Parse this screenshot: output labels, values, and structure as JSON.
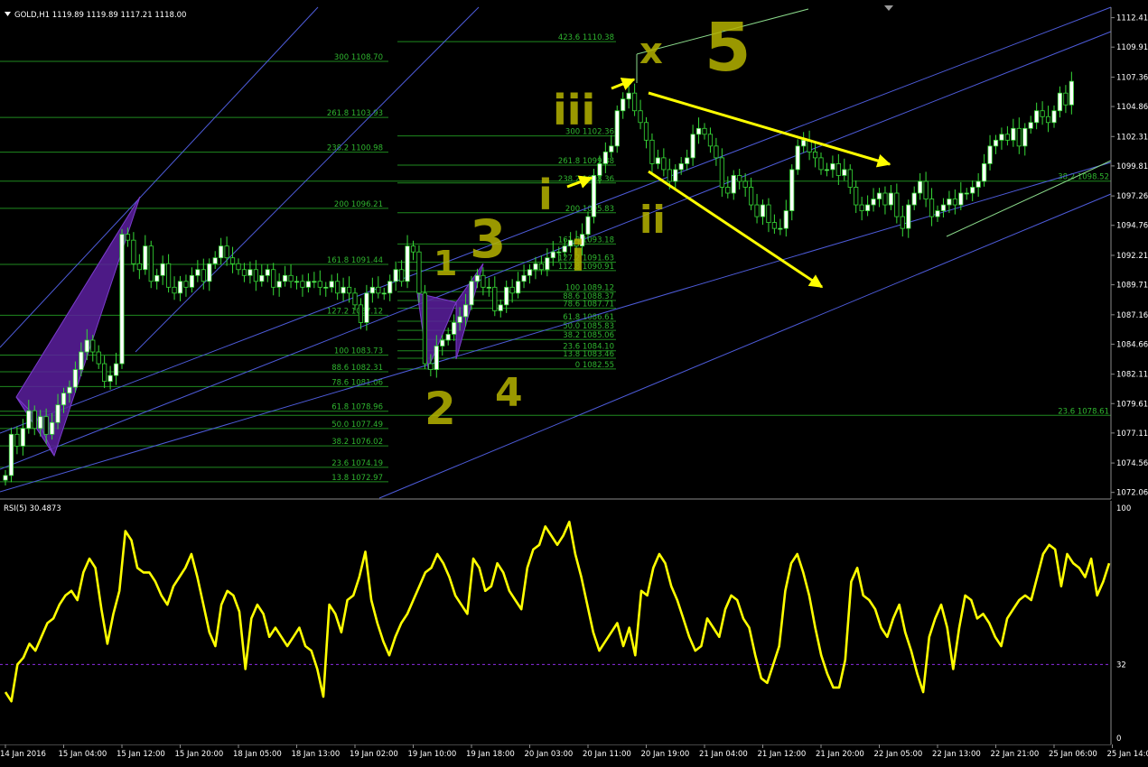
{
  "window": {
    "symbol_title": "GOLD,H1",
    "ohlc": "1119.89 1119.89 1117.21 1118.00",
    "title_full": "GOLD,H1  1119.89 1119.89 1117.21 1118.00"
  },
  "chart_data": [
    {
      "type": "line",
      "role": "candlestick-price",
      "title": "GOLD,H1",
      "ylim": [
        1071.5,
        1113.3
      ],
      "y_ticks": [
        "1112.41",
        "1109.91",
        "1107.36",
        "1104.86",
        "1102.31",
        "1099.81",
        "1097.26",
        "1094.76",
        "1092.21",
        "1089.71",
        "1087.16",
        "1084.66",
        "1082.11",
        "1079.61",
        "1077.11",
        "1074.56",
        "1072.06"
      ],
      "x_ticks": [
        "14 Jan 2016",
        "15 Jan 04:00",
        "15 Jan 12:00",
        "15 Jan 20:00",
        "18 Jan 05:00",
        "18 Jan 13:00",
        "19 Jan 02:00",
        "19 Jan 10:00",
        "19 Jan 18:00",
        "20 Jan 03:00",
        "20 Jan 11:00",
        "20 Jan 19:00",
        "21 Jan 04:00",
        "21 Jan 12:00",
        "21 Jan 20:00",
        "22 Jan 05:00",
        "22 Jan 13:00",
        "22 Jan 21:00",
        "25 Jan 06:00",
        "25 Jan 14:00"
      ],
      "x_tick_index": [
        0,
        10,
        20,
        30,
        40,
        50,
        60,
        70,
        80,
        90,
        100,
        110,
        120,
        130,
        140,
        150,
        160,
        170,
        180,
        190
      ],
      "candles_close_approx": [
        1073.5,
        1077.0,
        1076.0,
        1077.5,
        1079.0,
        1077.5,
        1078.5,
        1077.0,
        1078.0,
        1079.5,
        1080.5,
        1081.0,
        1082.5,
        1084.0,
        1085.0,
        1084.0,
        1083.0,
        1081.5,
        1082.0,
        1083.0,
        1094.0,
        1093.5,
        1091.5,
        1091.0,
        1093.0,
        1090.0,
        1090.5,
        1091.5,
        1089.5,
        1089.0,
        1090.0,
        1089.5,
        1090.5,
        1091.0,
        1090.0,
        1091.5,
        1092.0,
        1093.0,
        1092.0,
        1091.5,
        1091.0,
        1090.5,
        1091.0,
        1090.0,
        1090.5,
        1091.0,
        1089.5,
        1090.0,
        1090.5,
        1090.0,
        1090.0,
        1089.5,
        1090.0,
        1090.0,
        1089.5,
        1089.5,
        1090.0,
        1089.0,
        1089.5,
        1089.0,
        1088.0,
        1086.5,
        1089.0,
        1089.5,
        1089.0,
        1089.0,
        1090.0,
        1091.0,
        1090.0,
        1093.0,
        1092.5,
        1089.0,
        1083.0,
        1082.5,
        1084.5,
        1085.0,
        1085.5,
        1086.5,
        1087.0,
        1088.0,
        1090.0,
        1090.5,
        1089.5,
        1089.5,
        1087.5,
        1088.0,
        1089.5,
        1089.0,
        1090.0,
        1090.5,
        1091.0,
        1091.5,
        1091.0,
        1092.0,
        1092.5,
        1092.5,
        1093.0,
        1093.5,
        1093.0,
        1094.0,
        1095.5,
        1099.0,
        1100.0,
        1101.0,
        1101.5,
        1104.5,
        1105.5,
        1106.0,
        1104.5,
        1103.5,
        1102.0,
        1100.0,
        1100.5,
        1099.5,
        1098.5,
        1099.5,
        1100.0,
        1100.5,
        1102.5,
        1103.0,
        1102.5,
        1101.5,
        1100.5,
        1098.0,
        1097.5,
        1099.0,
        1098.5,
        1098.0,
        1096.5,
        1095.5,
        1096.5,
        1095.0,
        1094.5,
        1094.5,
        1096.0,
        1099.5,
        1101.5,
        1102.0,
        1101.0,
        1100.5,
        1099.5,
        1099.5,
        1100.0,
        1099.0,
        1099.5,
        1098.0,
        1096.5,
        1096.0,
        1096.5,
        1097.0,
        1097.5,
        1096.5,
        1097.5,
        1095.5,
        1094.5,
        1096.5,
        1097.5,
        1098.5,
        1097.0,
        1095.5,
        1096.0,
        1096.5,
        1097.0,
        1096.5,
        1097.5,
        1097.5,
        1098.0,
        1098.5,
        1100.0,
        1101.5,
        1102.0,
        1102.5,
        1102.0,
        1103.0,
        1101.5,
        1103.0,
        1103.5,
        1104.5,
        1104.0,
        1103.5,
        1104.5,
        1106.0,
        1105.0,
        1107.0
      ]
    },
    {
      "type": "line",
      "role": "indicator",
      "title": "RSI(5) 30.4873",
      "ylim": [
        0,
        100
      ],
      "y_ticks": [
        "100",
        "32",
        "0"
      ],
      "level": 32,
      "values_approx": [
        20,
        16,
        32,
        35,
        41,
        38,
        44,
        50,
        52,
        58,
        62,
        64,
        60,
        72,
        78,
        74,
        56,
        41,
        54,
        64,
        90,
        86,
        74,
        72,
        72,
        68,
        62,
        58,
        66,
        70,
        74,
        80,
        70,
        58,
        46,
        40,
        58,
        64,
        62,
        55,
        30,
        52,
        58,
        54,
        44,
        48,
        44,
        40,
        44,
        48,
        40,
        38,
        30,
        18,
        58,
        54,
        46,
        60,
        62,
        70,
        81,
        60,
        50,
        42,
        36,
        44,
        50,
        54,
        60,
        66,
        72,
        74,
        80,
        76,
        70,
        62,
        58,
        54,
        78,
        74,
        64,
        66,
        76,
        72,
        64,
        60,
        56,
        74,
        82,
        84,
        92,
        88,
        84,
        88,
        94,
        80,
        70,
        58,
        46,
        38,
        42,
        46,
        50,
        40,
        48,
        36,
        64,
        62,
        74,
        80,
        76,
        66,
        60,
        52,
        44,
        38,
        40,
        52,
        48,
        44,
        56,
        62,
        60,
        52,
        48,
        36,
        26,
        24,
        32,
        40,
        64,
        76,
        80,
        72,
        62,
        48,
        36,
        28,
        22,
        22,
        34,
        68,
        74,
        62,
        60,
        56,
        48,
        44,
        52,
        58,
        46,
        38,
        28,
        20,
        44,
        52,
        58,
        48,
        30,
        48,
        62,
        60,
        52,
        54,
        50,
        44,
        40,
        52,
        56,
        60,
        62,
        60,
        70,
        80,
        84,
        82,
        66,
        80,
        76,
        74,
        70,
        78,
        62,
        68,
        76
      ],
      "color": "#ffff00"
    }
  ],
  "fibo_left": [
    {
      "label": "300  1108.70",
      "price": 1108.7
    },
    {
      "label": "261.8  1103.93",
      "price": 1103.93
    },
    {
      "label": "238.2  1100.98",
      "price": 1100.98
    },
    {
      "label": "200  1096.21",
      "price": 1096.21
    },
    {
      "label": "161.8  1091.44",
      "price": 1091.44
    },
    {
      "label": "127.2  1087.12",
      "price": 1087.12
    },
    {
      "label": "100  1083.73",
      "price": 1083.73
    },
    {
      "label": "88.6  1082.31",
      "price": 1082.31
    },
    {
      "label": "78.6  1081.06",
      "price": 1081.06
    },
    {
      "label": "61.8  1078.96",
      "price": 1078.96
    },
    {
      "label": "50.0  1077.49",
      "price": 1077.49
    },
    {
      "label": "38.2  1076.02",
      "price": 1076.02
    },
    {
      "label": "23.6  1074.19",
      "price": 1074.19
    },
    {
      "label": "13.8  1072.97",
      "price": 1072.97
    }
  ],
  "fibo_right": [
    {
      "label": "423.6  1110.38",
      "price": 1110.38
    },
    {
      "label": "300  1102.36",
      "price": 1102.36
    },
    {
      "label": "261.8  1099.88",
      "price": 1099.88
    },
    {
      "label": "238.2  1098.36",
      "price": 1098.36
    },
    {
      "label": "200  1095.83",
      "price": 1095.83
    },
    {
      "label": "161.8  1093.18",
      "price": 1093.18
    },
    {
      "label": "127.2  1091.63",
      "price": 1091.63
    },
    {
      "label": "112.8  1090.91",
      "price": 1090.91
    },
    {
      "label": "100  1089.12",
      "price": 1089.12
    },
    {
      "label": "88.6  1088.37",
      "price": 1088.37
    },
    {
      "label": "78.6  1087.71",
      "price": 1087.71
    },
    {
      "label": "61.8  1086.61",
      "price": 1086.61
    },
    {
      "label": "50.0  1085.83",
      "price": 1085.83
    },
    {
      "label": "38.2  1085.06",
      "price": 1085.06
    },
    {
      "label": "23.6  1084.10",
      "price": 1084.1
    },
    {
      "label": "13.8  1083.46",
      "price": 1083.46
    },
    {
      "label": "0  1082.55",
      "price": 1082.55
    }
  ],
  "fibo_extra": [
    {
      "label": "38.2  1098.52",
      "price": 1098.52
    },
    {
      "label": "23.6  1078.61",
      "price": 1078.61
    }
  ],
  "wave_labels": {
    "w1": "1",
    "w2": "2",
    "w3": "3",
    "w4": "4",
    "wiii_top": "iii",
    "wi": "i",
    "wii": "ii",
    "wi_low": "i",
    "wx": "x",
    "w5": "5"
  },
  "colors": {
    "background": "#000000",
    "grid_fibo": "#1f8a1f",
    "fibo_text": "#2fb52f",
    "channel": "#4d5bd9",
    "bull_candle": "#ffffff",
    "bear_candle": "#000000",
    "wick": "#36d936",
    "rsi": "#ffff00",
    "annotation": "#b5b300",
    "arrow": "#ffff00",
    "harmonic": "#5a1e9e"
  }
}
